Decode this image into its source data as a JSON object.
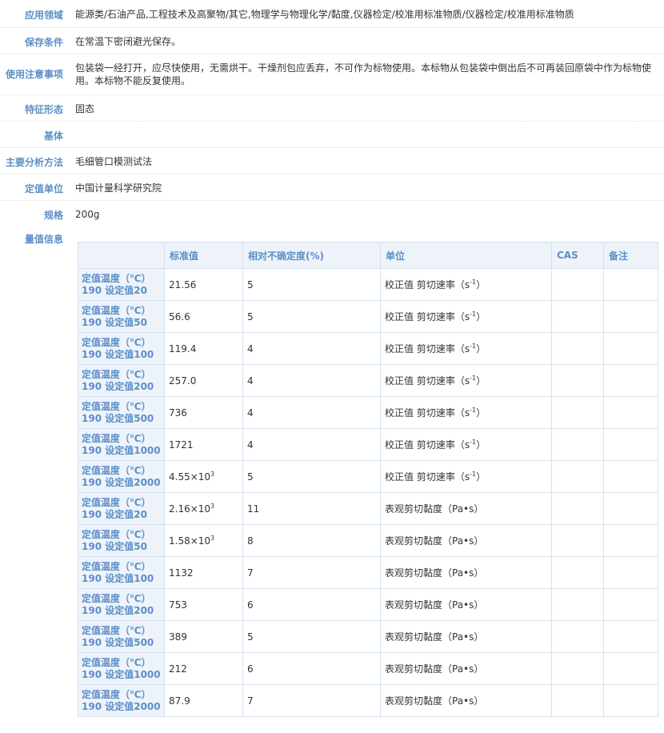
{
  "info": {
    "field": {
      "label": "应用领域",
      "value": "能源类/石油产品,工程技术及高聚物/其它,物理学与物理化学/黏度,仪器检定/校准用标准物质/仪器检定/校准用标准物质"
    },
    "storage": {
      "label": "保存条件",
      "value": "在常温下密闭避光保存。"
    },
    "notice": {
      "label": "使用注意事项",
      "value": "包装袋一经打开，应尽快使用，无需烘干。干燥剂包应丢弃，不可作为标物使用。本标物从包装袋中倒出后不可再装回原袋中作为标物使用。本标物不能反复使用。"
    },
    "form": {
      "label": "特征形态",
      "value": "固态"
    },
    "matrix": {
      "label": "基体",
      "value": ""
    },
    "method": {
      "label": "主要分析方法",
      "value": "毛细管口模测试法"
    },
    "unit": {
      "label": "定值单位",
      "value": "中国计量科学研究院"
    },
    "spec": {
      "label": "规格",
      "value": "200g"
    }
  },
  "quantity": {
    "label": "量值信息",
    "headers": [
      "",
      "标准值",
      "相对不确定度(%)",
      "单位",
      "CAS",
      "备注"
    ],
    "rows": [
      {
        "cond1": "定值温度（℃）",
        "cond2": "190 设定值20",
        "value": "21.56",
        "exp": "",
        "unc": "5",
        "unit": "校正值 剪切速率（s",
        "unit_sup": "-1",
        "unit_tail": "）",
        "cas": "",
        "note": ""
      },
      {
        "cond1": "定值温度（℃）",
        "cond2": "190 设定值50",
        "value": "56.6",
        "exp": "",
        "unc": "5",
        "unit": "校正值 剪切速率（s",
        "unit_sup": "-1",
        "unit_tail": "）",
        "cas": "",
        "note": ""
      },
      {
        "cond1": "定值温度（℃）",
        "cond2": "190 设定值100",
        "value": "119.4",
        "exp": "",
        "unc": "4",
        "unit": "校正值 剪切速率（s",
        "unit_sup": "-1",
        "unit_tail": "）",
        "cas": "",
        "note": ""
      },
      {
        "cond1": "定值温度（℃）",
        "cond2": "190 设定值200",
        "value": "257.0",
        "exp": "",
        "unc": "4",
        "unit": "校正值 剪切速率（s",
        "unit_sup": "-1",
        "unit_tail": "）",
        "cas": "",
        "note": ""
      },
      {
        "cond1": "定值温度（℃）",
        "cond2": "190 设定值500",
        "value": "736",
        "exp": "",
        "unc": "4",
        "unit": "校正值 剪切速率（s",
        "unit_sup": "-1",
        "unit_tail": "）",
        "cas": "",
        "note": ""
      },
      {
        "cond1": "定值温度（℃）",
        "cond2": "190 设定值1000",
        "value": "1721",
        "exp": "",
        "unc": "4",
        "unit": "校正值 剪切速率（s",
        "unit_sup": "-1",
        "unit_tail": "）",
        "cas": "",
        "note": ""
      },
      {
        "cond1": "定值温度（℃）",
        "cond2": "190 设定值2000",
        "value": "4.55×10",
        "exp": "3",
        "unc": "5",
        "unit": "校正值 剪切速率（s",
        "unit_sup": "-1",
        "unit_tail": "）",
        "cas": "",
        "note": ""
      },
      {
        "cond1": "定值温度（℃）",
        "cond2": "190 设定值20",
        "value": "2.16×10",
        "exp": "3",
        "unc": "11",
        "unit": "表观剪切黏度（Pa•s）",
        "unit_sup": "",
        "unit_tail": "",
        "cas": "",
        "note": ""
      },
      {
        "cond1": "定值温度（℃）",
        "cond2": "190 设定值50",
        "value": "1.58×10",
        "exp": "3",
        "unc": "8",
        "unit": "表观剪切黏度（Pa•s）",
        "unit_sup": "",
        "unit_tail": "",
        "cas": "",
        "note": ""
      },
      {
        "cond1": "定值温度（℃）",
        "cond2": "190 设定值100",
        "value": "1132",
        "exp": "",
        "unc": "7",
        "unit": "表观剪切黏度（Pa•s）",
        "unit_sup": "",
        "unit_tail": "",
        "cas": "",
        "note": ""
      },
      {
        "cond1": "定值温度（℃）",
        "cond2": "190 设定值200",
        "value": "753",
        "exp": "",
        "unc": "6",
        "unit": "表观剪切黏度（Pa•s）",
        "unit_sup": "",
        "unit_tail": "",
        "cas": "",
        "note": ""
      },
      {
        "cond1": "定值温度（℃）",
        "cond2": "190 设定值500",
        "value": "389",
        "exp": "",
        "unc": "5",
        "unit": "表观剪切黏度（Pa•s）",
        "unit_sup": "",
        "unit_tail": "",
        "cas": "",
        "note": ""
      },
      {
        "cond1": "定值温度（℃）",
        "cond2": "190 设定值1000",
        "value": "212",
        "exp": "",
        "unc": "6",
        "unit": "表观剪切黏度（Pa•s）",
        "unit_sup": "",
        "unit_tail": "",
        "cas": "",
        "note": ""
      },
      {
        "cond1": "定值温度（℃）",
        "cond2": "190 设定值2000",
        "value": "87.9",
        "exp": "",
        "unc": "7",
        "unit": "表观剪切黏度（Pa•s）",
        "unit_sup": "",
        "unit_tail": "",
        "cas": "",
        "note": ""
      }
    ]
  }
}
